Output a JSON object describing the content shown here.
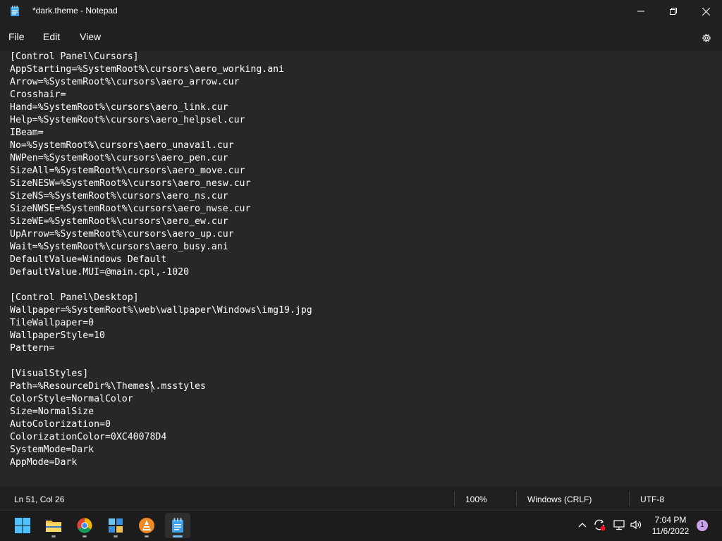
{
  "window": {
    "title": "*dark.theme - Notepad",
    "icon": "notepad-icon"
  },
  "menu": {
    "file": "File",
    "edit": "Edit",
    "view": "View",
    "settings_icon": "gear-icon"
  },
  "editor": {
    "lines": [
      "[Control Panel\\Cursors]",
      "AppStarting=%SystemRoot%\\cursors\\aero_working.ani",
      "Arrow=%SystemRoot%\\cursors\\aero_arrow.cur",
      "Crosshair=",
      "Hand=%SystemRoot%\\cursors\\aero_link.cur",
      "Help=%SystemRoot%\\cursors\\aero_helpsel.cur",
      "IBeam=",
      "No=%SystemRoot%\\cursors\\aero_unavail.cur",
      "NWPen=%SystemRoot%\\cursors\\aero_pen.cur",
      "SizeAll=%SystemRoot%\\cursors\\aero_move.cur",
      "SizeNESW=%SystemRoot%\\cursors\\aero_nesw.cur",
      "SizeNS=%SystemRoot%\\cursors\\aero_ns.cur",
      "SizeNWSE=%SystemRoot%\\cursors\\aero_nwse.cur",
      "SizeWE=%SystemRoot%\\cursors\\aero_ew.cur",
      "UpArrow=%SystemRoot%\\cursors\\aero_up.cur",
      "Wait=%SystemRoot%\\cursors\\aero_busy.ani",
      "DefaultValue=Windows Default",
      "DefaultValue.MUI=@main.cpl,-1020",
      "",
      "[Control Panel\\Desktop]",
      "Wallpaper=%SystemRoot%\\web\\wallpaper\\Windows\\img19.jpg",
      "TileWallpaper=0",
      "WallpaperStyle=10",
      "Pattern=",
      "",
      "[VisualStyles]",
      "Path=%ResourceDir%\\Themes\\.msstyles",
      "ColorStyle=NormalColor",
      "Size=NormalSize",
      "AutoColorization=0",
      "ColorizationColor=0XC40078D4",
      "SystemMode=Dark",
      "AppMode=Dark"
    ]
  },
  "status": {
    "position": "Ln 51, Col 26",
    "zoom": "100%",
    "line_ending": "Windows (CRLF)",
    "encoding": "UTF-8"
  },
  "taskbar": {
    "apps": [
      "start-icon",
      "file-explorer-icon",
      "chrome-icon",
      "store-icon",
      "vlc-icon",
      "notepad-icon"
    ],
    "time": "7:04 PM",
    "date": "11/6/2022",
    "notification_count": "1"
  },
  "colors": {
    "editor_bg": "#272727",
    "chrome_bg": "#202020",
    "taskbar_bg": "#1c1c1c",
    "accent": "#76b9ed"
  }
}
